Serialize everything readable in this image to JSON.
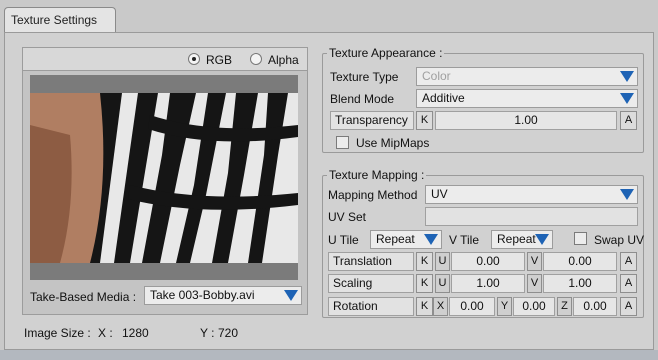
{
  "tab": {
    "label": "Texture Settings"
  },
  "preview": {
    "channel_rgb": "RGB",
    "channel_alpha": "Alpha",
    "take_media_label": "Take-Based Media :",
    "take_media_value": "Take 003-Bobby.avi"
  },
  "image_size": {
    "label": "Image Size :",
    "x_label": "X :",
    "x_value": "1280",
    "y_label": "Y :",
    "y_value": "720"
  },
  "appearance": {
    "title": "Texture Appearance :",
    "texture_type_label": "Texture Type",
    "texture_type_value": "Color",
    "blend_mode_label": "Blend Mode",
    "blend_mode_value": "Additive",
    "transparency_label": "Transparency",
    "transparency_value": "1.00",
    "use_mipmaps_label": "Use MipMaps"
  },
  "mapping": {
    "title": "Texture Mapping :",
    "method_label": "Mapping Method",
    "method_value": "UV",
    "uv_set_label": "UV Set",
    "utile_label": "U Tile",
    "utile_value": "Repeat",
    "vtile_label": "V Tile",
    "vtile_value": "Repeat",
    "swap_uv_label": "Swap UV",
    "translation_label": "Translation",
    "translation_u": "0.00",
    "translation_v": "0.00",
    "scaling_label": "Scaling",
    "scaling_u": "1.00",
    "scaling_v": "1.00",
    "rotation_label": "Rotation",
    "rotation_x": "0.00",
    "rotation_y": "0.00",
    "rotation_z": "0.00"
  },
  "buttons": {
    "key": "K",
    "anim": "A",
    "u": "U",
    "v": "V",
    "x": "X",
    "y": "Y",
    "z": "Z"
  },
  "colors": {
    "accent_arrow": "#1e63b5",
    "panel": "#d1d1d1"
  }
}
